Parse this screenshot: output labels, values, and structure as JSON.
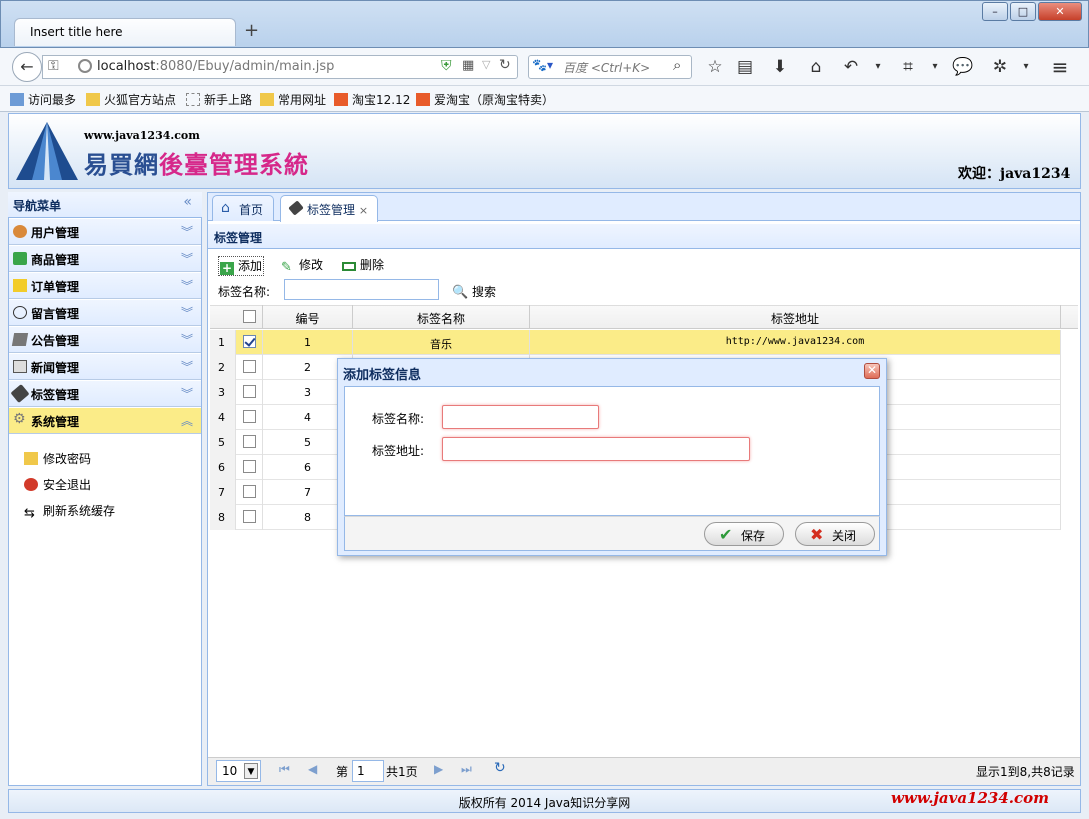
{
  "browser": {
    "tab_title": "Insert title here",
    "new_tab": "+",
    "url_host": "localhost",
    "url_rest": ":8080/Ebuy/admin/main.jsp",
    "search_placeholder": "百度 <Ctrl+K>",
    "window_buttons": [
      "–",
      "□",
      "✕"
    ],
    "bookmarks": [
      "访问最多",
      "火狐官方站点",
      "新手上路",
      "常用网址",
      "淘宝12.12",
      "爱淘宝（原淘宝特卖）"
    ]
  },
  "header": {
    "logo_url": "www.java1234.com",
    "logo_title_a": "易買網",
    "logo_title_b": "後臺管理系統",
    "welcome": "欢迎：java1234"
  },
  "sidebar": {
    "title": "导航菜单",
    "collapse_icon": "«",
    "items": [
      {
        "label": "用户管理",
        "icon": "user-icon"
      },
      {
        "label": "商品管理",
        "icon": "product-icon"
      },
      {
        "label": "订单管理",
        "icon": "order-icon"
      },
      {
        "label": "留言管理",
        "icon": "message-icon"
      },
      {
        "label": "公告管理",
        "icon": "notice-icon"
      },
      {
        "label": "新闻管理",
        "icon": "news-icon"
      },
      {
        "label": "标签管理",
        "icon": "tag-icon"
      },
      {
        "label": "系统管理",
        "icon": "gear-icon"
      }
    ],
    "subitems": [
      "修改密码",
      "安全退出",
      "刷新系统缓存"
    ]
  },
  "tabs": [
    {
      "label": "首页"
    },
    {
      "label": "标签管理",
      "close": "×"
    }
  ],
  "panel": {
    "title": "标签管理",
    "toolbar": {
      "add": "添加",
      "edit": "修改",
      "delete": "删除"
    },
    "search_label": "标签名称:",
    "search_button": "搜索"
  },
  "grid": {
    "columns": [
      "编号",
      "标签名称",
      "标签地址"
    ],
    "rows": [
      {
        "n": "1",
        "id": "1",
        "name": "音乐",
        "url": "http://www.java1234.com",
        "checked": true
      },
      {
        "n": "2",
        "id": "2",
        "name": "",
        "url": "",
        "checked": false
      },
      {
        "n": "3",
        "id": "3",
        "name": "",
        "url": "",
        "checked": false
      },
      {
        "n": "4",
        "id": "4",
        "name": "",
        "url": "",
        "checked": false
      },
      {
        "n": "5",
        "id": "5",
        "name": "",
        "url": "",
        "checked": false
      },
      {
        "n": "6",
        "id": "6",
        "name": "",
        "url": "",
        "checked": false
      },
      {
        "n": "7",
        "id": "7",
        "name": "",
        "url": "",
        "checked": false
      },
      {
        "n": "8",
        "id": "8",
        "name": "",
        "url": "",
        "checked": false
      }
    ]
  },
  "pager": {
    "page_size": "10",
    "page_prefix": "第",
    "page_value": "1",
    "page_total": "共1页",
    "summary": "显示1到8,共8记录"
  },
  "footer": {
    "copyright": "版权所有 2014 Java知识分享网",
    "url": "www.java1234.com"
  },
  "dialog": {
    "title": "添加标签信息",
    "close": "✕",
    "name_label": "标签名称:",
    "url_label": "标签地址:",
    "save": "保存",
    "cancel": "关闭"
  },
  "colors": {
    "accent": "#95b8e7",
    "selected": "#fbec88",
    "brand_pink": "#d6288a",
    "footer_red": "#d10000"
  }
}
